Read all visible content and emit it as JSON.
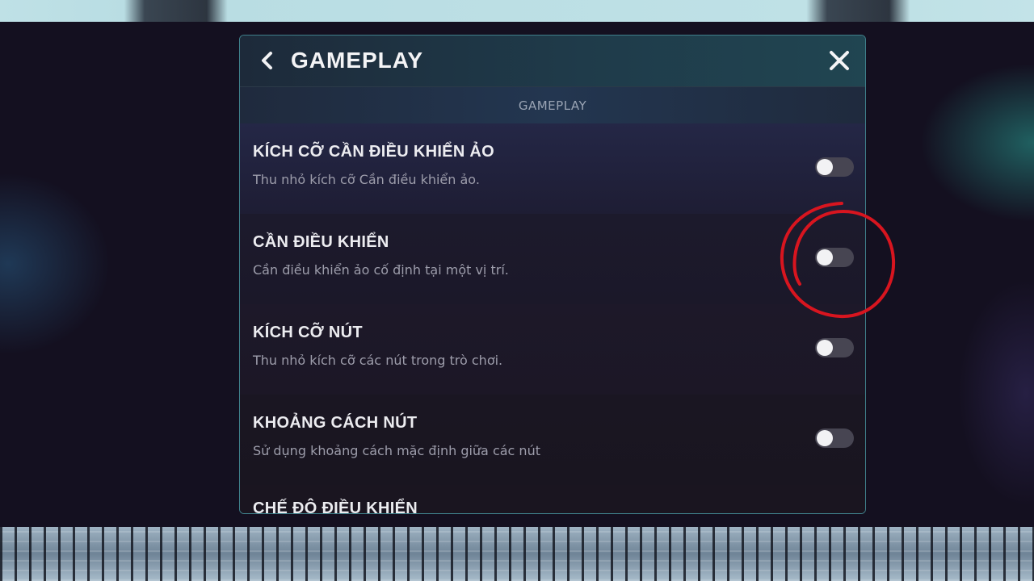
{
  "header": {
    "title": "GAMEPLAY",
    "back_icon": "chevron-left-icon",
    "close_icon": "close-icon"
  },
  "section": {
    "label": "GAMEPLAY"
  },
  "settings": [
    {
      "title": "KÍCH CỠ CẦN ĐIỀU KHIỂN ẢO",
      "description": "Thu nhỏ kích cỡ Cần điều khiển ảo.",
      "enabled": false
    },
    {
      "title": "CẦN ĐIỀU KHIỂN",
      "description": "Cần điều khiển ảo cố định tại một vị trí.",
      "enabled": false
    },
    {
      "title": "KÍCH CỠ NÚT",
      "description": "Thu nhỏ kích cỡ các nút trong trò chơi.",
      "enabled": false
    },
    {
      "title": "KHOẢNG CÁCH NÚT",
      "description": "Sử dụng khoảng cách mặc định giữa các nút",
      "enabled": false
    },
    {
      "title": "CHẾ ĐỘ ĐIỀU KHIỂN"
    }
  ],
  "colors": {
    "panel_border": "#3f7f8a",
    "annotation_circle": "#d8151f",
    "toggle_off_track": "#474552",
    "toggle_knob": "#f2f2f4"
  }
}
